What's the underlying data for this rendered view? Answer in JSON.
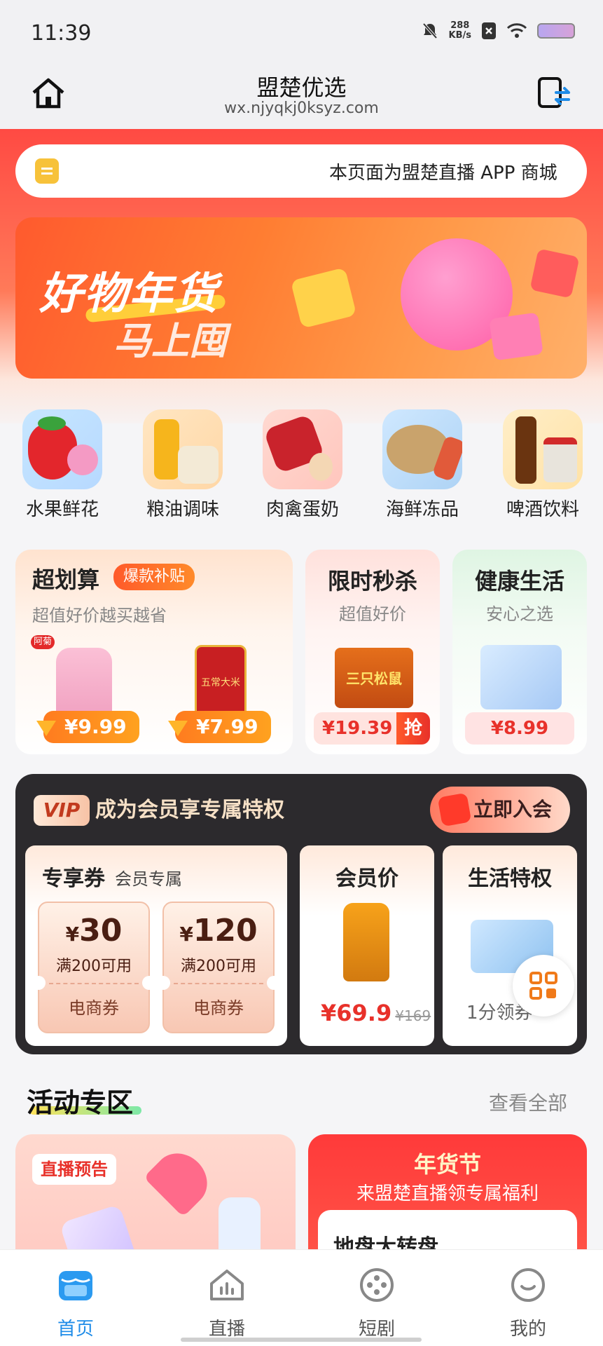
{
  "status": {
    "time": "11:39",
    "speed_value": "288",
    "speed_unit": "KB/s"
  },
  "header": {
    "title": "盟楚优选",
    "url": "wx.njyqkj0ksyz.com"
  },
  "notice": {
    "text": "本页面为盟楚直播 APP 商城"
  },
  "banner": {
    "line1": "好物年货",
    "line2": "马上囤"
  },
  "categories": [
    {
      "label": "水果鲜花"
    },
    {
      "label": "粮油调味"
    },
    {
      "label": "肉禽蛋奶"
    },
    {
      "label": "海鲜冻品"
    },
    {
      "label": "啤酒饮料"
    }
  ],
  "deals": {
    "main": {
      "title": "超划算",
      "badge": "爆款补贴",
      "subtitle": "超值好价越买越省",
      "brand": "阿菊",
      "rice_label": "五常大米",
      "prices": [
        "¥9.99",
        "¥7.99"
      ]
    },
    "flash": {
      "title": "限时秒杀",
      "subtitle": "超值好价",
      "price": "¥19.39",
      "grab": "抢",
      "box_label": "三只松鼠"
    },
    "health": {
      "title": "健康生活",
      "subtitle": "安心之选",
      "price": "¥8.99"
    }
  },
  "member": {
    "vip": "VIP",
    "title": "成为会员享专属特权",
    "join": "立即入会",
    "coupon_title": "专享券",
    "coupon_sub": "会员专属",
    "coupons": [
      {
        "currency": "¥",
        "amount": "30",
        "condition": "满200可用",
        "type": "电商券"
      },
      {
        "currency": "¥",
        "amount": "120",
        "condition": "满200可用",
        "type": "电商券"
      }
    ],
    "member_price_title": "会员价",
    "member_price": "¥69.9",
    "original_price": "¥169",
    "life_title": "生活特权",
    "life_text": "1分领券"
  },
  "activity": {
    "title": "活动专区",
    "more": "查看全部",
    "left_tag": "直播预告",
    "right_title": "年货节",
    "right_sub": "来盟楚直播领专属福利",
    "right_inner": "地盘大转盘"
  },
  "nav": [
    {
      "label": "首页",
      "icon": "home-store-icon",
      "active": true
    },
    {
      "label": "直播",
      "icon": "live-house-icon",
      "active": false
    },
    {
      "label": "短剧",
      "icon": "film-reel-icon",
      "active": false
    },
    {
      "label": "我的",
      "icon": "profile-smile-icon",
      "active": false
    }
  ],
  "colors": {
    "accent": "#ff4a43",
    "nav_active": "#1f8ce8",
    "price": "#e8312a"
  }
}
